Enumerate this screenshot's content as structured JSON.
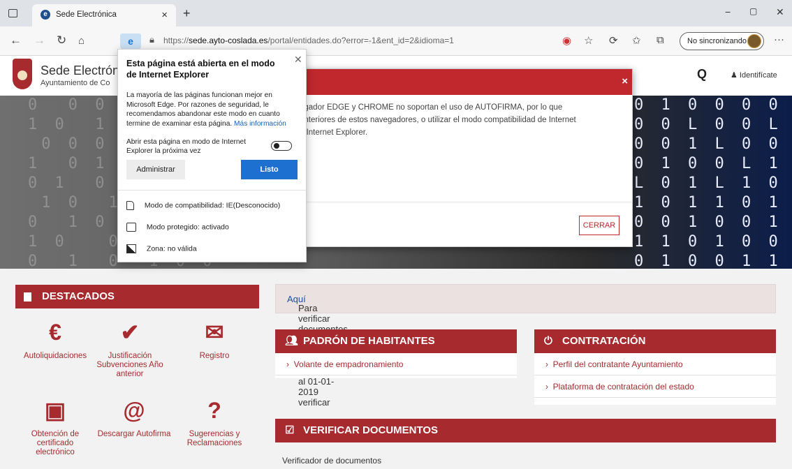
{
  "browser": {
    "tab_title": "Sede Electrónica",
    "tab_close": "×",
    "new_tab": "+",
    "url_prefix": "https://",
    "url_domain": "sede.ayto-coslada.es",
    "url_path": "/portal/entidades.do?error=-1&ent_id=2&idioma=1",
    "sync_label": "No sincronizando",
    "win_minimize": "−",
    "win_maximize": "▢",
    "win_close": "✕",
    "more": "···"
  },
  "ie_popup": {
    "title": "Esta página está abierta en el modo de Internet Explorer",
    "description": "La mayoría de las páginas funcionan mejor en Microsoft Edge. Por razones de seguridad, le recomendamos abandonar este modo en cuanto termine de examinar esta página.",
    "more_info_link": "Más información",
    "toggle_label": "Abrir esta página en modo de Internet Explorer la próxima vez",
    "admin_button": "Administrar",
    "done_button": "Listo",
    "rows": [
      {
        "icon": "document-icon",
        "text": "Modo de compatibilidad: IE(Desconocido)"
      },
      {
        "icon": "protected-mode-icon",
        "text": "Modo protegido: activado"
      },
      {
        "icon": "zone-icon",
        "text": "Zona: no válida"
      }
    ]
  },
  "site": {
    "title": "Sede Electróni",
    "subtitle": "Ayuntamiento de Co",
    "identify": "Identifícate"
  },
  "modal": {
    "close_x": "×",
    "line1": "egador EDGE y CHROME no soportan el uso de AUTOFIRMA, por lo que",
    "line2": "anteriores de estos navegadores, o utilizar el modo compatibilidad de Internet",
    "line3": "o Internet Explorer.",
    "close_button": "CERRAR"
  },
  "destacados": {
    "title": "DESTACADOS",
    "items": [
      {
        "icon": "€",
        "label": "Autoliquidaciones"
      },
      {
        "icon": "✔",
        "label": "Justificación Subvenciones Año anterior"
      },
      {
        "icon": "✉",
        "label": "Registro"
      },
      {
        "icon": "▣",
        "label": "Obtención de certificado electrónico"
      },
      {
        "icon": "@",
        "label": "Descargar Autofirma"
      },
      {
        "icon": "?",
        "label": "Sugerencias y Reclamaciones"
      }
    ]
  },
  "notice": {
    "text": "Para verificar documentos del Patronato de deportes Anteriores al 01-01-2019 verificar ",
    "link": "Aquí",
    "end": "."
  },
  "padron": {
    "title": "PADRÓN DE HABITANTES",
    "items": [
      "Volante de empadronamiento"
    ]
  },
  "contratacion": {
    "title": "CONTRATACIÓN",
    "items": [
      "Perfil del contratante Ayuntamiento",
      "Plataforma de contratación del estado"
    ]
  },
  "verificar": {
    "title": "VERIFICAR DOCUMENTOS",
    "text": "Verificador de documentos"
  },
  "colors": {
    "brand_red": "#a72a2e",
    "modal_red": "#c0282d",
    "edge_blue": "#1d6fd0"
  }
}
